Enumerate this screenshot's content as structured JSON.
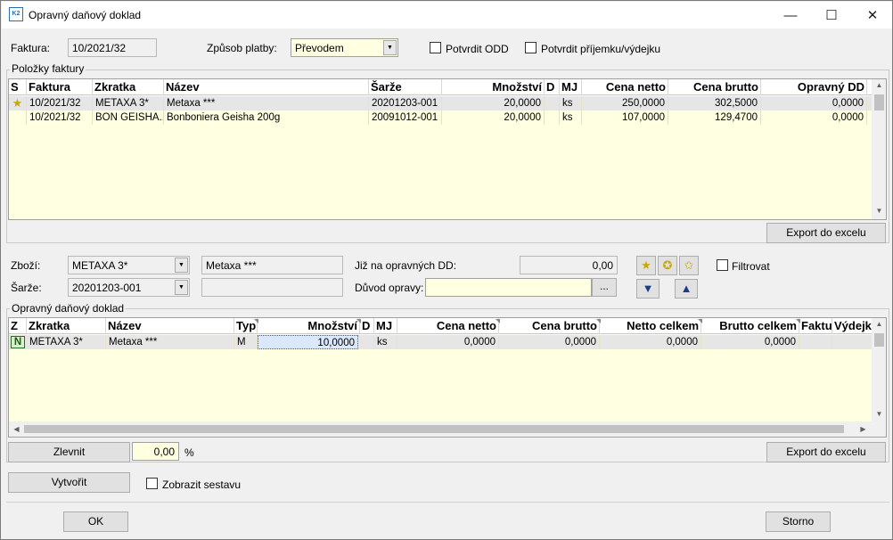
{
  "window": {
    "title": "Opravný daňový doklad",
    "icon_text": "K2"
  },
  "header": {
    "faktura_label": "Faktura:",
    "faktura_value": "10/2021/32",
    "zpusob_label": "Způsob platby:",
    "zpusob_value": "Převodem",
    "potvrdit_odd_label": "Potvrdit ODD",
    "potvrdit_prijemku_label": "Potvrdit příjemku/výdejku"
  },
  "invoice_items": {
    "group_title": "Položky faktury",
    "columns": [
      "S",
      "Faktura",
      "Zkratka",
      "Název",
      "Šarže",
      "Množství",
      "D",
      "MJ",
      "Cena netto",
      "Cena brutto",
      "Opravný DD"
    ],
    "rows": [
      [
        "",
        "10/2021/32",
        "METAXA 3*",
        "Metaxa ***",
        "20201203-001",
        "20,0000",
        "",
        "ks",
        "250,0000",
        "302,5000",
        "0,0000"
      ],
      [
        "",
        "10/2021/32",
        "BON GEISHA...",
        "Bonboniera Geisha 200g",
        "20091012-001",
        "20,0000",
        "",
        "ks",
        "107,0000",
        "129,4700",
        "0,0000"
      ]
    ],
    "export_label": "Export do excelu"
  },
  "detail": {
    "zbozi_label": "Zboží:",
    "zbozi_value": "METAXA 3*",
    "zbozi_name": "Metaxa ***",
    "sarze_label": "Šarže:",
    "sarze_value": "20201203-001",
    "sarze_name": "",
    "jiz_label": "Již na opravných DD:",
    "jiz_value": "0,00",
    "duvod_label": "Důvod opravy:",
    "duvod_value": "",
    "duvod_btn": "...",
    "filtrovat_label": "Filtrovat"
  },
  "correction": {
    "group_title": "Opravný daňový doklad",
    "columns": [
      "Z",
      "Zkratka",
      "Název",
      "Typ",
      "Množství",
      "D",
      "MJ",
      "Cena netto",
      "Cena brutto",
      "Netto celkem",
      "Brutto celkem",
      "Faktu",
      "Výdejk"
    ],
    "rows": [
      [
        "N",
        "METAXA 3*",
        "Metaxa ***",
        "M",
        "10,0000",
        "",
        "ks",
        "0,0000",
        "0,0000",
        "0,0000",
        "0,0000",
        "",
        ""
      ]
    ],
    "zlevnit_label": "Zlevnit",
    "zlevnit_value": "0,00",
    "percent": "%",
    "export_label": "Export do excelu"
  },
  "footer": {
    "vytvorit_label": "Vytvořit",
    "zobrazit_label": "Zobrazit sestavu",
    "ok_label": "OK",
    "storno_label": "Storno"
  }
}
